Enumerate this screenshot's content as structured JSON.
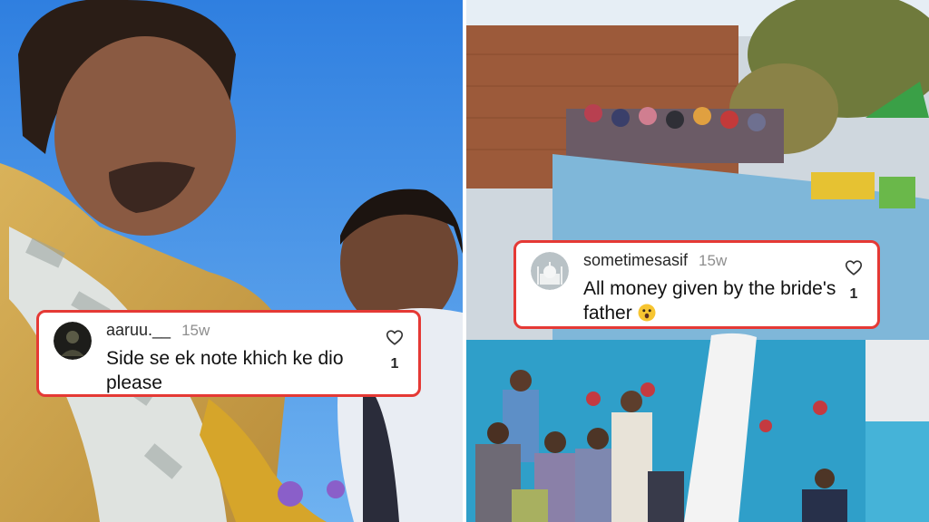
{
  "left_panel": {
    "comment": {
      "username": "aaruu.__",
      "timestamp": "15w",
      "text": "Side se ek note khich ke dio please",
      "like_count": "1",
      "avatar_icon": "dark-avatar-icon"
    }
  },
  "right_panel": {
    "comment": {
      "username": "sometimesasif",
      "timestamp": "15w",
      "text": "All money given by the bride's father",
      "emoji_icon": "astonished-face-emoji",
      "like_count": "1",
      "avatar_icon": "taj-mahal-avatar-icon"
    }
  },
  "colors": {
    "highlight_border": "#e53935",
    "sky": "#3f8fe6",
    "wall_blue": "#2f9fc9"
  }
}
